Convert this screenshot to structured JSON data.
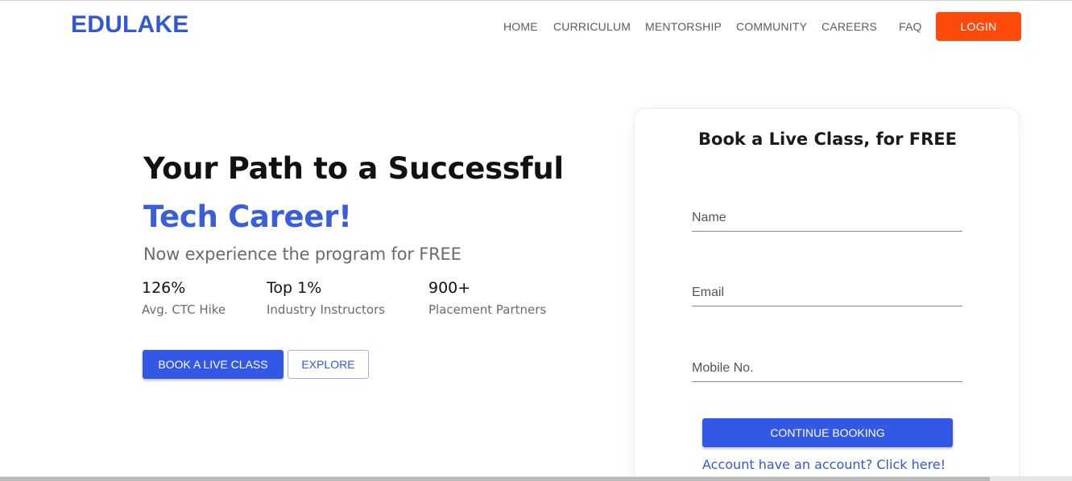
{
  "header": {
    "logo": "EDULAKE",
    "nav": [
      "HOME",
      "CURRICULUM",
      "MENTORSHIP",
      "COMMUNITY",
      "CAREERS",
      "FAQ"
    ],
    "login_label": "LOGIN"
  },
  "hero": {
    "title_line1": "Your Path to a Successful",
    "title_line2": "Tech Career!",
    "subtitle": "Now experience the program for FREE",
    "stats": [
      {
        "value": "126%",
        "label": "Avg. CTC Hike"
      },
      {
        "value": "Top 1%",
        "label": "Industry Instructors"
      },
      {
        "value": "900+",
        "label": "Placement Partners"
      }
    ],
    "book_label": "BOOK A LIVE CLASS",
    "explore_label": "EXPLORE"
  },
  "form": {
    "title": "Book a Live Class, for FREE",
    "name_placeholder": "Name",
    "email_placeholder": "Email",
    "mobile_placeholder": "Mobile No.",
    "continue_label": "CONTINUE BOOKING",
    "account_link": "Account have an account? Click here!"
  },
  "colors": {
    "brand_blue": "#3358d4",
    "button_blue": "#3358e6",
    "login_orange": "#ff4a0e"
  }
}
